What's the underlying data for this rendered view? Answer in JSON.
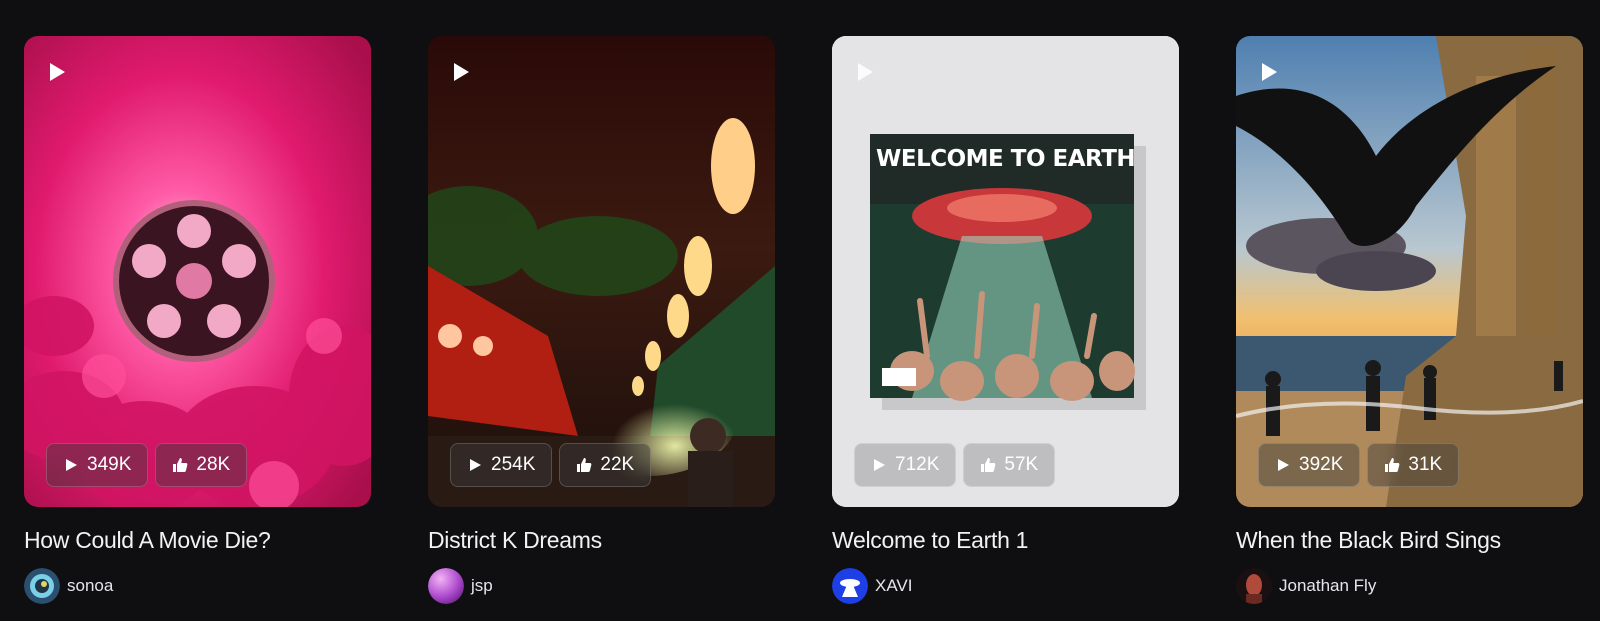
{
  "cards": [
    {
      "title": "How Could A Movie Die?",
      "author": "sonoa",
      "plays": "349K",
      "likes": "28K",
      "avatar_icon": "swirl-avatar",
      "accent": "#e8237a"
    },
    {
      "title": "District K Dreams",
      "author": "jsp",
      "plays": "254K",
      "likes": "22K",
      "avatar_icon": "purple-orb-avatar",
      "accent": "#c72a1e"
    },
    {
      "title": "Welcome to Earth 1",
      "author": "XAVI",
      "plays": "712K",
      "likes": "57K",
      "cover_text": "WELCOME TO EARTH",
      "avatar_icon": "ufo-avatar",
      "accent": "#1f3fe6"
    },
    {
      "title": "When the Black Bird Sings",
      "author": "Jonathan Fly",
      "plays": "392K",
      "likes": "31K",
      "avatar_icon": "portrait-avatar",
      "accent": "#d9a24a"
    }
  ]
}
